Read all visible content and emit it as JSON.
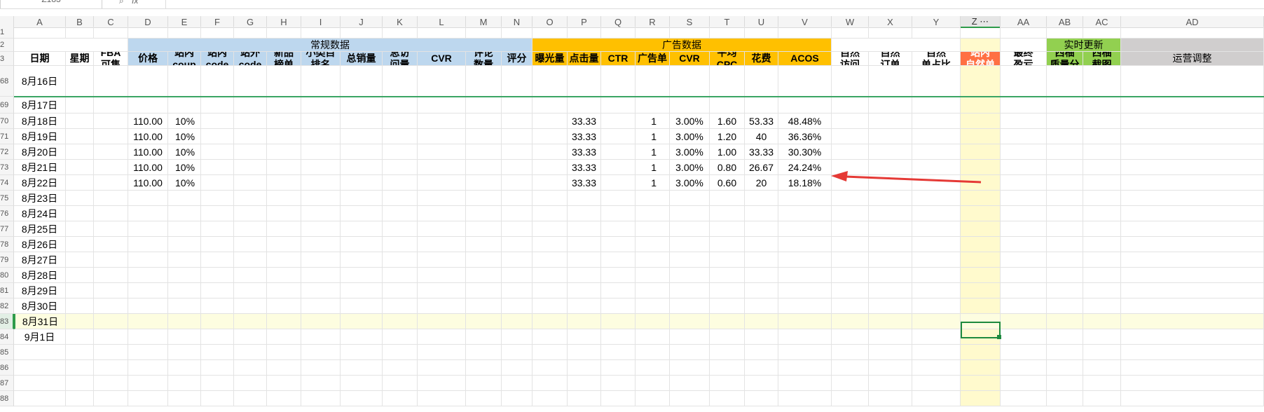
{
  "formula_bar": {
    "name_box": "Z183",
    "fx": "fx"
  },
  "columns": [
    "A",
    "B",
    "C",
    "D",
    "E",
    "F",
    "G",
    "H",
    "I",
    "J",
    "K",
    "L",
    "M",
    "N",
    "O",
    "P",
    "Q",
    "R",
    "S",
    "T",
    "U",
    "V",
    "W",
    "X",
    "Y",
    "Z",
    "AA",
    "AB",
    "AC",
    "AD"
  ],
  "selected_column_label": "Z ⋯",
  "row_numbers": [
    "1",
    "2",
    "3",
    "68",
    "69",
    "70",
    "71",
    "72",
    "73",
    "74",
    "75",
    "76",
    "77",
    "78",
    "79",
    "80",
    "81",
    "82",
    "83",
    "84",
    "85",
    "86",
    "87",
    "88"
  ],
  "group_headers": {
    "regular": "常规数据",
    "ads": "广告数据",
    "realtime": "实时更新"
  },
  "headers": [
    "日期",
    "星期",
    "FBA\n可售",
    "价格",
    "站内\ncoup",
    "站内\ncode",
    "站外\ncode",
    "新品\n榜单",
    "小类目\n排名",
    "总销量",
    "总访\n问量",
    "CVR",
    "评论\n数量",
    "评分",
    "曝光量",
    "点击量",
    "CTR",
    "广告单",
    "CVR",
    "平均\nCPC",
    "花费",
    "ACOS",
    "自然\n访问",
    "自然\n订单",
    "自然\n单占比",
    "站内\n自然单",
    "最终\n盈亏",
    "西柚\n质量分",
    "西柚\n截图",
    "运营调整"
  ],
  "dates": [
    "8月16日",
    "8月17日",
    "8月18日",
    "8月19日",
    "8月20日",
    "8月21日",
    "8月22日",
    "8月23日",
    "8月24日",
    "8月25日",
    "8月26日",
    "8月27日",
    "8月28日",
    "8月29日",
    "8月30日",
    "8月31日",
    "9月1日"
  ],
  "data_rows": [
    {
      "price": "110.00",
      "coup": "10%",
      "clicks": "33.33",
      "ad_orders": "1",
      "cvr": "3.00%",
      "cpc": "1.60",
      "spend": "53.33",
      "acos": "48.48%"
    },
    {
      "price": "110.00",
      "coup": "10%",
      "clicks": "33.33",
      "ad_orders": "1",
      "cvr": "3.00%",
      "cpc": "1.20",
      "spend": "40",
      "acos": "36.36%"
    },
    {
      "price": "110.00",
      "coup": "10%",
      "clicks": "33.33",
      "ad_orders": "1",
      "cvr": "3.00%",
      "cpc": "1.00",
      "spend": "33.33",
      "acos": "30.30%"
    },
    {
      "price": "110.00",
      "coup": "10%",
      "clicks": "33.33",
      "ad_orders": "1",
      "cvr": "3.00%",
      "cpc": "0.80",
      "spend": "26.67",
      "acos": "24.24%"
    },
    {
      "price": "110.00",
      "coup": "10%",
      "clicks": "33.33",
      "ad_orders": "1",
      "cvr": "3.00%",
      "cpc": "0.60",
      "spend": "20",
      "acos": "18.18%"
    }
  ],
  "colors": {
    "blue_header": "#bdd7ee",
    "orange_header": "#ffc000",
    "green_header": "#92d050",
    "red_header": "#ff7043",
    "gray_header": "#d0cece",
    "highlight_col": "#fffacd",
    "arrow": "#e53935",
    "selection": "#1e8a3f"
  }
}
